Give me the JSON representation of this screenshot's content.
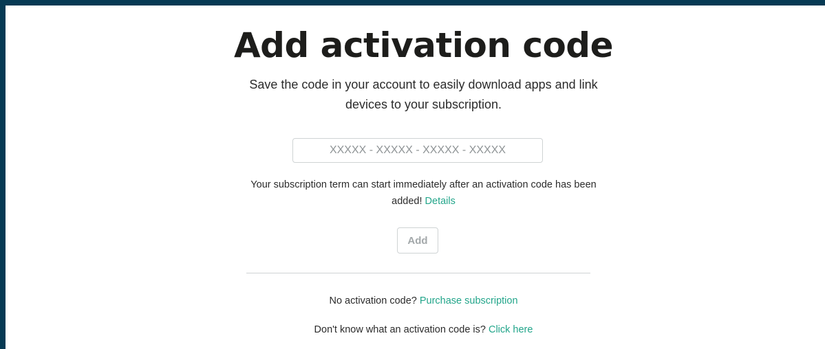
{
  "page": {
    "title": "Add activation code",
    "subtitle": "Save the code in your account to easily download apps and link devices to your subscription."
  },
  "code_input": {
    "placeholder": "XXXXX - XXXXX - XXXXX - XXXXX",
    "value": ""
  },
  "note": {
    "text": "Your subscription term can start immediately after an activation code has been added! ",
    "details_link": "Details"
  },
  "add_button": {
    "label": "Add"
  },
  "footer": {
    "purchase_prompt": "No activation code? ",
    "purchase_link": "Purchase subscription",
    "help_prompt": "Don't know what an activation code is? ",
    "help_link": "Click here"
  },
  "colors": {
    "frame": "#063a54",
    "link": "#22a58a",
    "title": "#1d1d1b",
    "border": "#cfd3d4",
    "button_disabled_text": "#a3a8aa"
  }
}
